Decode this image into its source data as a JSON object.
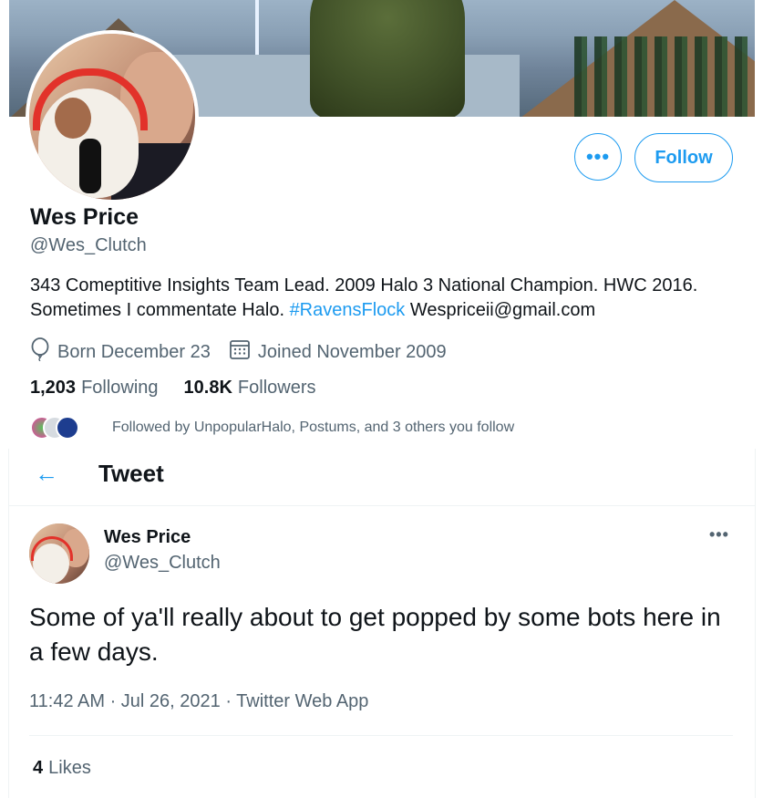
{
  "profile": {
    "name": "Wes Price",
    "handle": "@Wes_Clutch",
    "bio_text": "343 Comeptitive Insights Team Lead. 2009 Halo 3 National Champion. HWC 2016. Sometimes I commentate Halo. ",
    "bio_hashtag": "#RavensFlock",
    "bio_email": " Wespriceii@gmail.com",
    "born": "Born December 23",
    "joined": "Joined November 2009",
    "following_count": "1,203",
    "following_label": "Following",
    "followers_count": "10.8K",
    "followers_label": "Followers",
    "followed_by": "Followed by UnpopularHalo, Postums, and 3 others you follow",
    "more_label": "•••",
    "follow_label": "Follow"
  },
  "tweet": {
    "header_title": "Tweet",
    "back_icon": "←",
    "author_name": "Wes Price",
    "author_handle": "@Wes_Clutch",
    "more_label": "•••",
    "text": "Some of ya'll really about to get popped by some bots here in a few days.",
    "timestamp": "11:42 AM · Jul 26, 2021 · Twitter Web App",
    "likes_count": "4",
    "likes_label": "Likes"
  },
  "colors": {
    "accent": "#1d9bf0",
    "secondary_text": "#536471",
    "primary_text": "#0f1419"
  },
  "icons": {
    "born": "balloon-icon",
    "joined": "calendar-icon",
    "back": "arrow-left-icon"
  }
}
